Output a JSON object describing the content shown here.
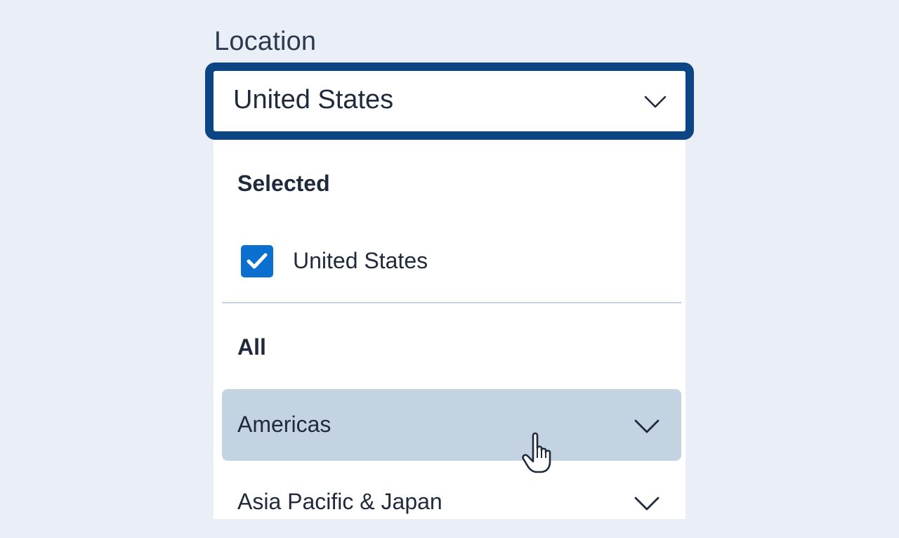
{
  "field": {
    "label": "Location",
    "value": "United States",
    "chevron_icon": "chevron-down-icon"
  },
  "dropdown": {
    "selected_heading": "Selected",
    "selected_items": [
      {
        "label": "United States",
        "checked": true
      }
    ],
    "all_heading": "All",
    "groups": [
      {
        "label": "Americas",
        "hovered": true
      },
      {
        "label": "Asia Pacific & Japan",
        "hovered": false
      }
    ]
  },
  "colors": {
    "focus_ring": "#0b4584",
    "checkbox": "#0b6fd0",
    "hover_row": "#c4d3e2",
    "background": "#eaeff7"
  },
  "cursor_icon": "hand-pointer-icon"
}
